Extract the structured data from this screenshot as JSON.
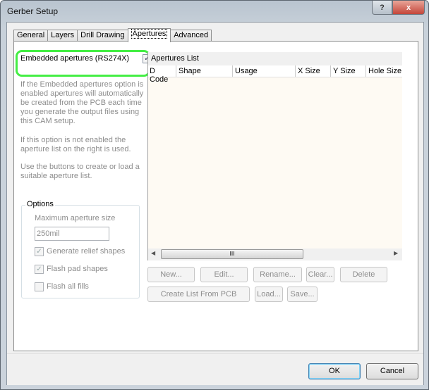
{
  "window": {
    "title": "Gerber Setup",
    "help_label": "?",
    "close_label": "x"
  },
  "tabs": [
    "General",
    "Layers",
    "Drill Drawing",
    "Apertures",
    "Advanced"
  ],
  "embedded": {
    "label": "Embedded apertures (RS274X)",
    "checked": true
  },
  "help_text": [
    "If the Embedded apertures option is enabled apertures will automatically be created from the PCB each time you generate the output files using this CAM setup.",
    "If this option is not enabled the aperture list on the right is used.",
    "Use the buttons to create or load a suitable aperture list."
  ],
  "options": {
    "title": "Options",
    "max_label": "Maximum aperture size",
    "max_value": "250mil",
    "relief": "Generate relief shapes",
    "flash_pad": "Flash pad shapes",
    "flash_fills": "Flash all fills"
  },
  "list": {
    "title": "Apertures List",
    "columns": [
      "D Code",
      "Shape",
      "Usage",
      "X Size",
      "Y Size",
      "Hole Size"
    ],
    "scroll_grip": "III"
  },
  "buttons": {
    "new": "New...",
    "edit": "Edit...",
    "rename": "Rename...",
    "clear": "Clear...",
    "delete": "Delete",
    "create": "Create List From PCB",
    "load": "Load...",
    "save": "Save..."
  },
  "dialog": {
    "ok": "OK",
    "cancel": "Cancel"
  },
  "highlight_color": "#44ee44"
}
